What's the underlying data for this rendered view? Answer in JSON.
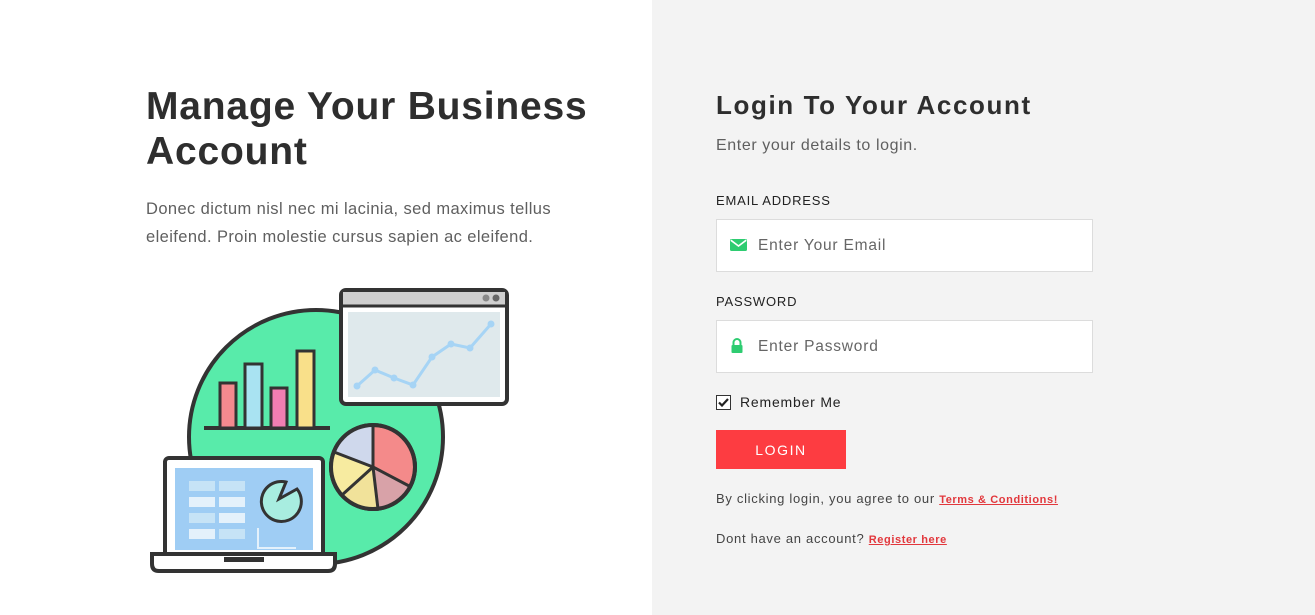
{
  "hero": {
    "title": "Manage Your Business Account",
    "description": "Donec dictum nisl nec mi lacinia, sed maximus tellus eleifend. Proin molestie cursus sapien ac eleifend."
  },
  "login": {
    "title": "Login To Your Account",
    "subtitle": "Enter your details to login.",
    "email_label": "EMAIL ADDRESS",
    "email_placeholder": "Enter Your Email",
    "email_value": "",
    "password_label": "PASSWORD",
    "password_placeholder": "Enter Password",
    "password_value": "",
    "remember_label": "Remember Me",
    "remember_checked": true,
    "button_label": "LOGIN",
    "terms_prefix": "By clicking login, you agree to our",
    "terms_link": "Terms & Conditions!",
    "register_prefix": "Dont have an account?",
    "register_link": "Register here"
  },
  "icons": {
    "email": "envelope-icon",
    "password": "lock-icon",
    "checkbox": "checkmark-icon"
  },
  "colors": {
    "accent": "#fd3c41",
    "icon_green": "#2ecc71",
    "right_panel_bg": "#f3f3f3",
    "illustration_circle": "#58ebaa"
  }
}
